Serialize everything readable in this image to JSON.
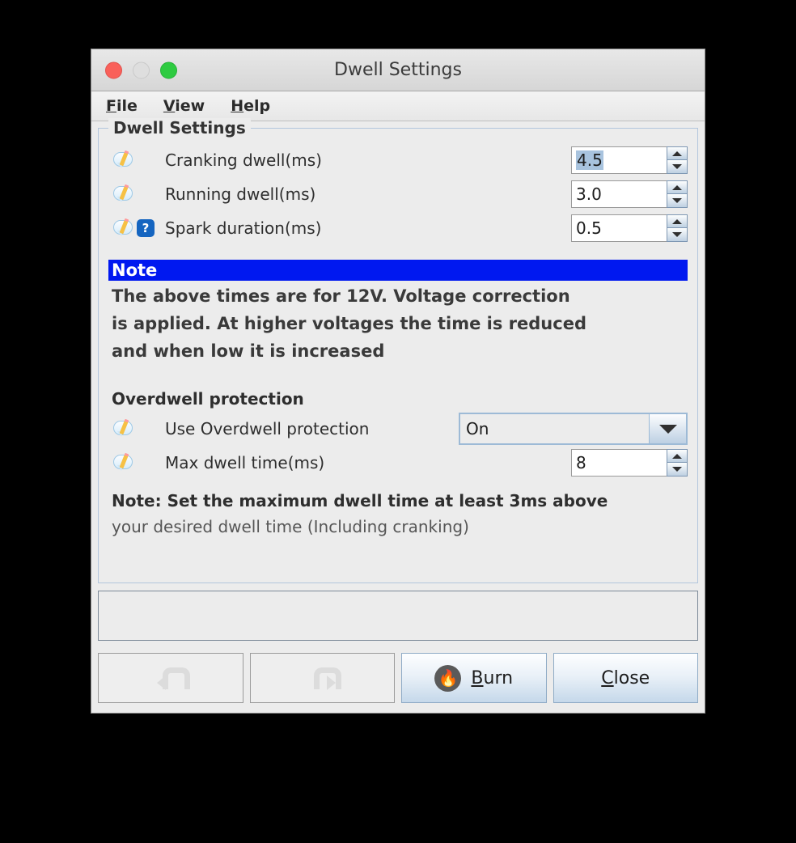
{
  "window": {
    "title": "Dwell Settings",
    "traffic_lights": [
      {
        "name": "close",
        "color": "#f9605a"
      },
      {
        "name": "minimize",
        "color": "#dedede"
      },
      {
        "name": "zoom",
        "color": "#2ecb41"
      }
    ]
  },
  "menubar": [
    {
      "label": "File",
      "mnemonic": "F",
      "rest": "ile"
    },
    {
      "label": "View",
      "mnemonic": "V",
      "rest": "iew"
    },
    {
      "label": "Help",
      "mnemonic": "H",
      "rest": "elp"
    }
  ],
  "group": {
    "title": "Dwell Settings",
    "fields": [
      {
        "label": "Cranking dwell(ms)",
        "value": "4.5",
        "selected": true,
        "help": false,
        "icon": "comment-edit-icon"
      },
      {
        "label": "Running dwell(ms)",
        "value": "3.0",
        "selected": false,
        "help": false,
        "icon": "comment-edit-icon"
      },
      {
        "label": "Spark duration(ms)",
        "value": "0.5",
        "selected": false,
        "help": true,
        "icon": "comment-edit-icon"
      }
    ],
    "note": {
      "heading": "Note",
      "lines": [
        "The above times are for 12V. Voltage correction",
        "is applied. At higher voltages the time is reduced",
        "and when low it is increased"
      ]
    },
    "overdwell": {
      "heading": "Overdwell protection",
      "use_label": "Use Overdwell protection",
      "use_value": "On",
      "max_label": "Max dwell time(ms)",
      "max_value": "8",
      "note_line1": "Note: Set the maximum dwell time at least 3ms above",
      "note_line2": "your desired dwell time (Including cranking)"
    }
  },
  "buttons": [
    {
      "name": "undo",
      "label": "",
      "icon": "undo-arrow-icon",
      "style": "plain",
      "enabled": false
    },
    {
      "name": "redo",
      "label": "",
      "icon": "redo-arrow-icon",
      "style": "plain",
      "enabled": false
    },
    {
      "name": "burn",
      "label": "Burn",
      "mnemonic": "B",
      "rest": "urn",
      "icon": "flame-icon",
      "style": "accent",
      "enabled": true
    },
    {
      "name": "close",
      "label": "Close",
      "mnemonic": "C",
      "rest": "lose",
      "icon": "",
      "style": "accent",
      "enabled": true
    }
  ],
  "colors": {
    "note_highlight": "#0018f0",
    "selection": "#a8c3de",
    "group_border": "#b3c6dd"
  }
}
